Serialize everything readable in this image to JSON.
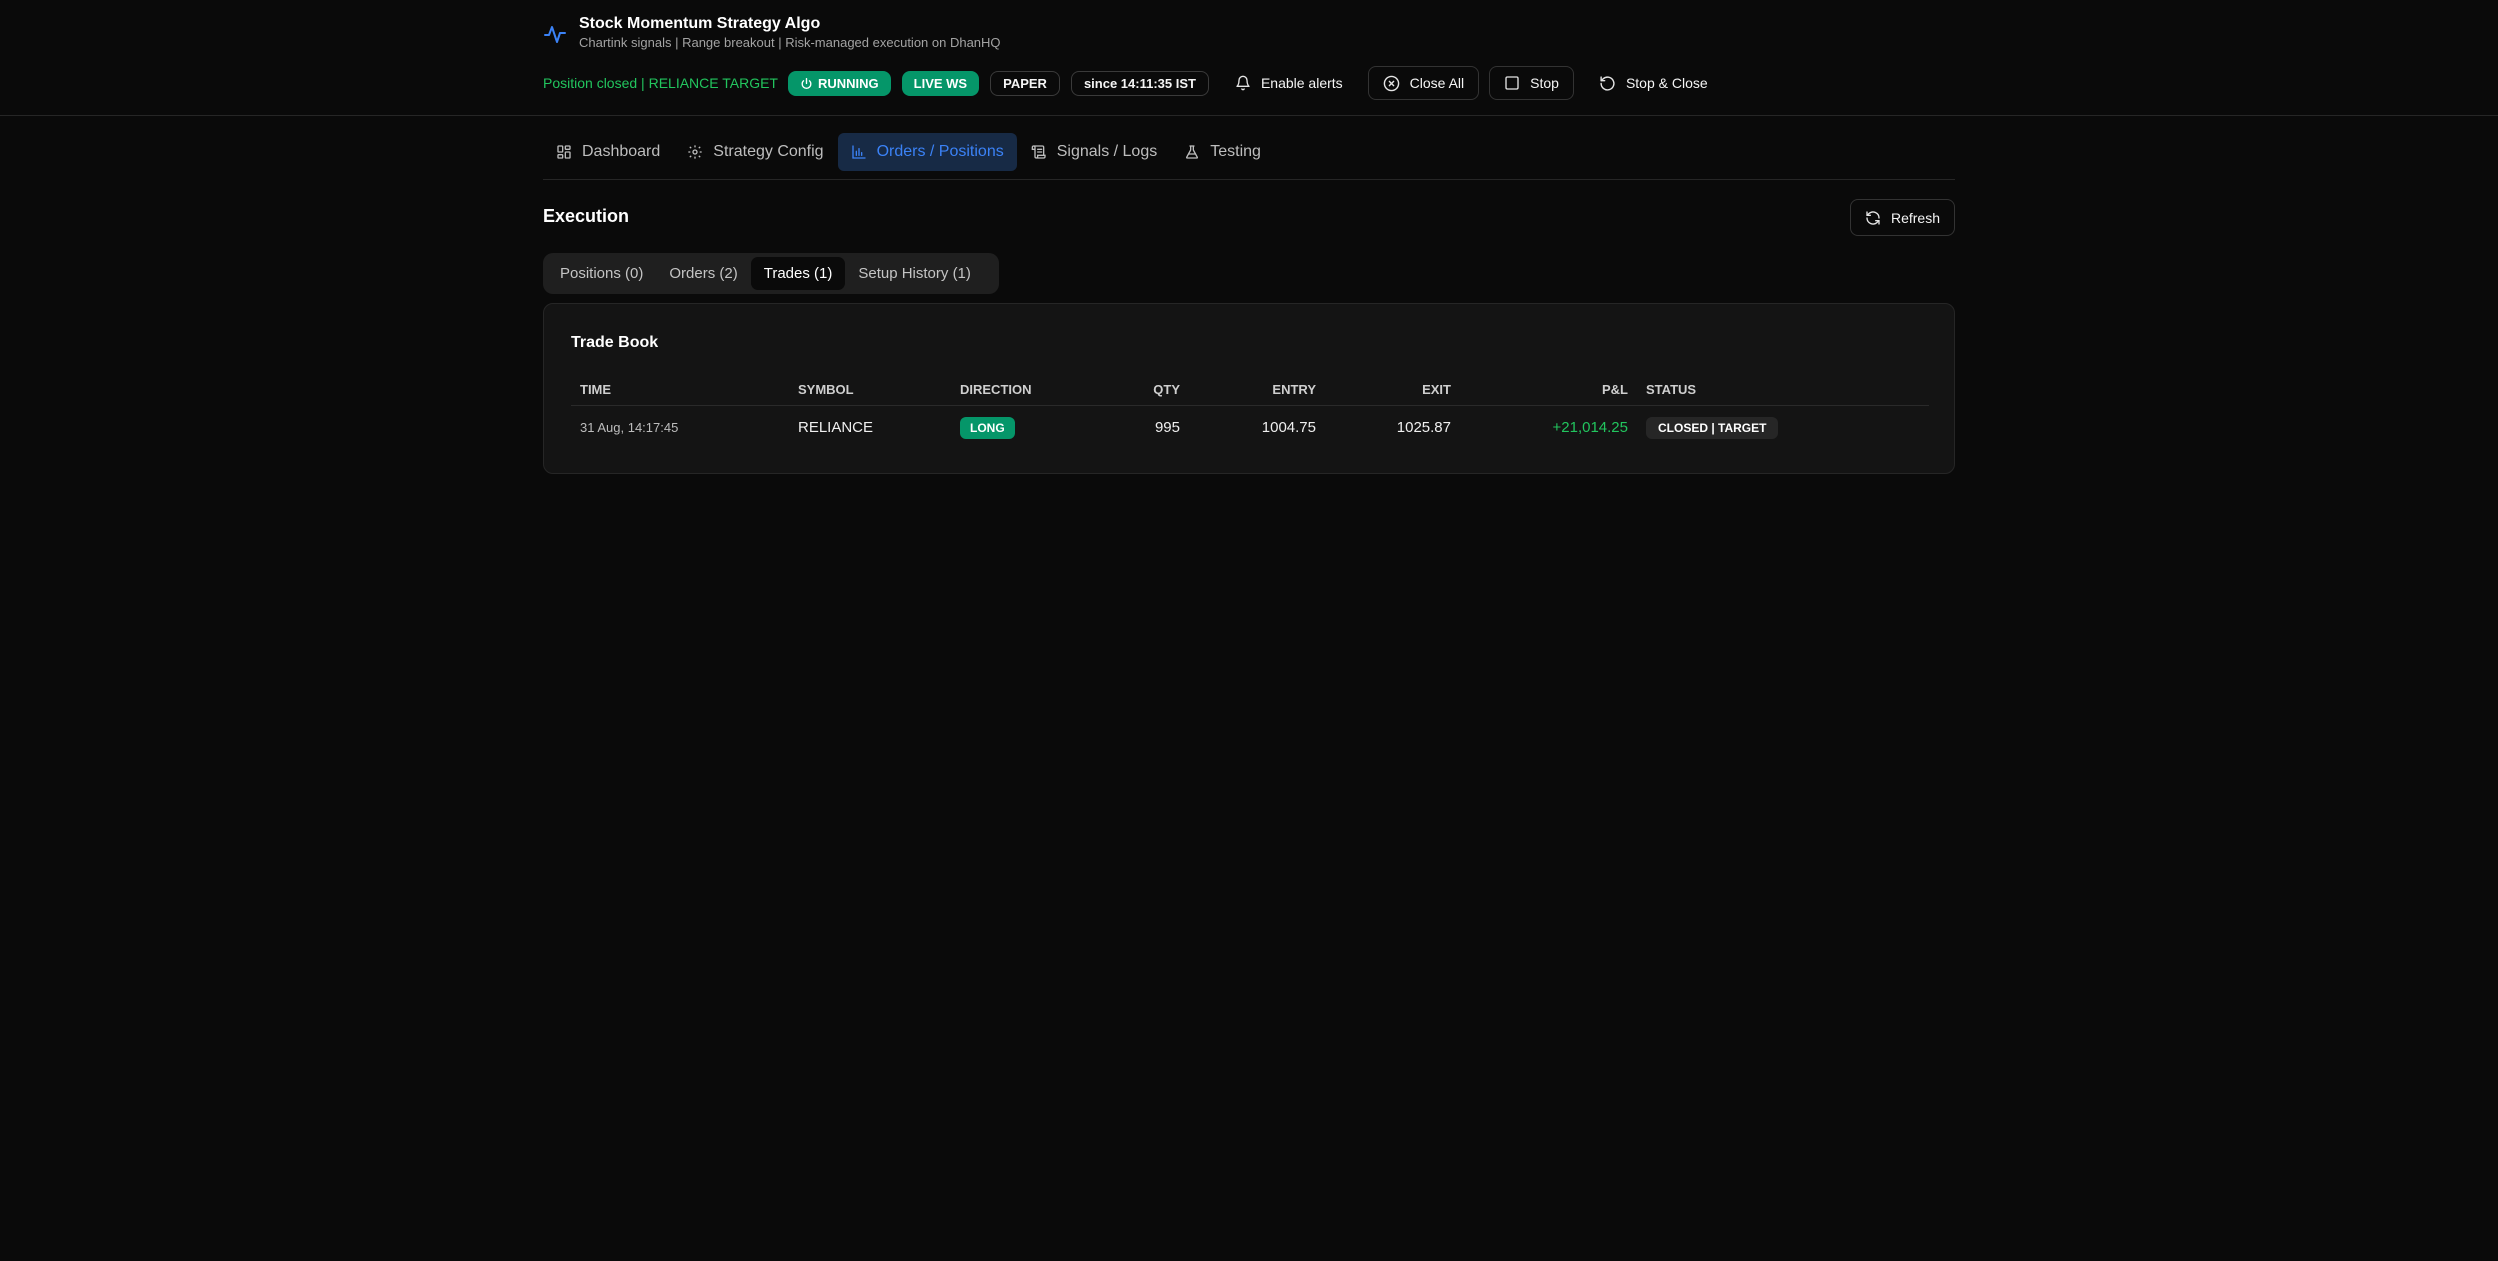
{
  "app": {
    "title": "Stock Momentum Strategy Algo",
    "subtitle": "Chartink signals | Range breakout | Risk-managed execution on DhanHQ"
  },
  "status": {
    "message": "Position closed | RELIANCE TARGET",
    "running": "RUNNING",
    "live_ws": "LIVE WS",
    "mode": "PAPER",
    "since": "since 14:11:35 IST"
  },
  "actions": {
    "enable_alerts": "Enable alerts",
    "close_all": "Close All",
    "stop": "Stop",
    "stop_close": "Stop & Close"
  },
  "nav": {
    "tabs": [
      {
        "label": "Dashboard",
        "icon": "grid-icon"
      },
      {
        "label": "Strategy Config",
        "icon": "gear-icon"
      },
      {
        "label": "Orders / Positions",
        "icon": "chart-icon"
      },
      {
        "label": "Signals / Logs",
        "icon": "scroll-icon"
      },
      {
        "label": "Testing",
        "icon": "flask-icon"
      }
    ],
    "active": "Orders / Positions"
  },
  "execution": {
    "title": "Execution",
    "refresh": "Refresh",
    "subtabs": [
      "Positions (0)",
      "Orders (2)",
      "Trades (1)",
      "Setup History (1)"
    ],
    "active_subtab": "Trades (1)"
  },
  "trade_book": {
    "title": "Trade Book",
    "columns": [
      "TIME",
      "SYMBOL",
      "DIRECTION",
      "QTY",
      "ENTRY",
      "EXIT",
      "P&L",
      "STATUS"
    ],
    "rows": [
      {
        "time": "31 Aug, 14:17:45",
        "symbol": "RELIANCE",
        "direction": "LONG",
        "qty": "995",
        "entry": "1004.75",
        "exit": "1025.87",
        "pnl": "+21,014.25",
        "status": "CLOSED | TARGET"
      }
    ]
  },
  "colors": {
    "accent_green": "#059669",
    "positive": "#22c55e",
    "active_blue": "#3b82f6",
    "background": "#0a0a0a"
  }
}
